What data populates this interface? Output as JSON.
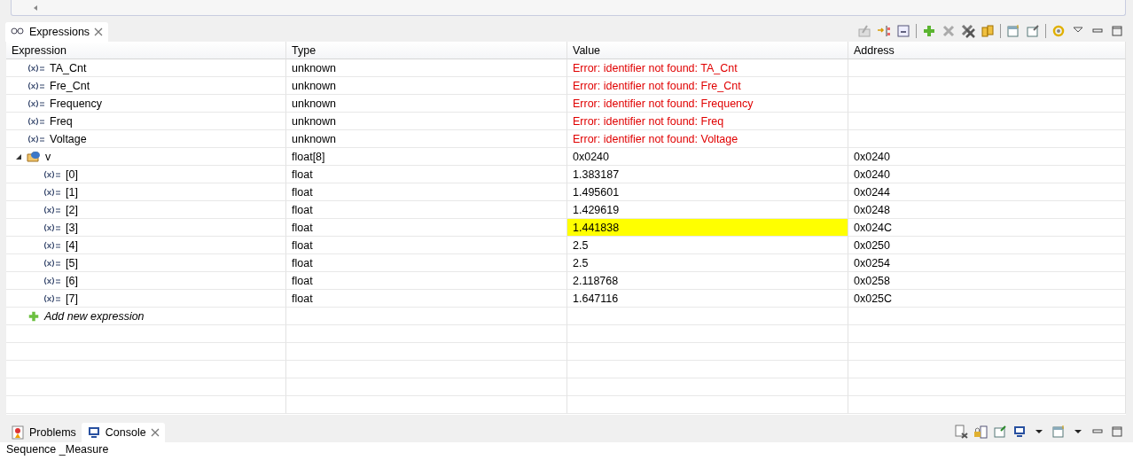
{
  "view_tabs": [
    {
      "label": "Expressions",
      "selected": true,
      "closable": true
    }
  ],
  "table": {
    "columns": [
      "Expression",
      "Type",
      "Value",
      "Address"
    ],
    "rows": [
      {
        "expression": "TA_Cnt",
        "type": "unknown",
        "value": "Error: identifier not found: TA_Cnt",
        "address": "",
        "kind": "variable",
        "error": true
      },
      {
        "expression": "Fre_Cnt",
        "type": "unknown",
        "value": "Error: identifier not found: Fre_Cnt",
        "address": "",
        "kind": "variable",
        "error": true
      },
      {
        "expression": "Frequency",
        "type": "unknown",
        "value": "Error: identifier not found: Frequency",
        "address": "",
        "kind": "variable",
        "error": true
      },
      {
        "expression": "Freq",
        "type": "unknown",
        "value": "Error: identifier not found: Freq",
        "address": "",
        "kind": "variable",
        "error": true
      },
      {
        "expression": "Voltage",
        "type": "unknown",
        "value": "Error: identifier not found: Voltage",
        "address": "",
        "kind": "variable",
        "error": true
      },
      {
        "expression": "v",
        "type": "float[8]",
        "value": "0x0240",
        "address": "0x0240",
        "kind": "array",
        "expanded": true,
        "children": [
          {
            "expression": "[0]",
            "type": "float",
            "value": "1.383187",
            "address": "0x0240",
            "changed": false
          },
          {
            "expression": "[1]",
            "type": "float",
            "value": "1.495601",
            "address": "0x0244",
            "changed": false
          },
          {
            "expression": "[2]",
            "type": "float",
            "value": "1.429619",
            "address": "0x0248",
            "changed": false
          },
          {
            "expression": "[3]",
            "type": "float",
            "value": "1.441838",
            "address": "0x024C",
            "changed": true
          },
          {
            "expression": "[4]",
            "type": "float",
            "value": "2.5",
            "address": "0x0250",
            "changed": false
          },
          {
            "expression": "[5]",
            "type": "float",
            "value": "2.5",
            "address": "0x0254",
            "changed": false
          },
          {
            "expression": "[6]",
            "type": "float",
            "value": "2.118768",
            "address": "0x0258",
            "changed": false
          },
          {
            "expression": "[7]",
            "type": "float",
            "value": "1.647116",
            "address": "0x025C",
            "changed": false
          }
        ]
      }
    ],
    "add_row": "Add new expression"
  },
  "bottom_tabs": [
    {
      "label": "Problems",
      "selected": false,
      "closable": false,
      "kind": "problems"
    },
    {
      "label": "Console",
      "selected": true,
      "closable": true,
      "kind": "console"
    }
  ],
  "console": {
    "text": "Sequence _Measure"
  }
}
